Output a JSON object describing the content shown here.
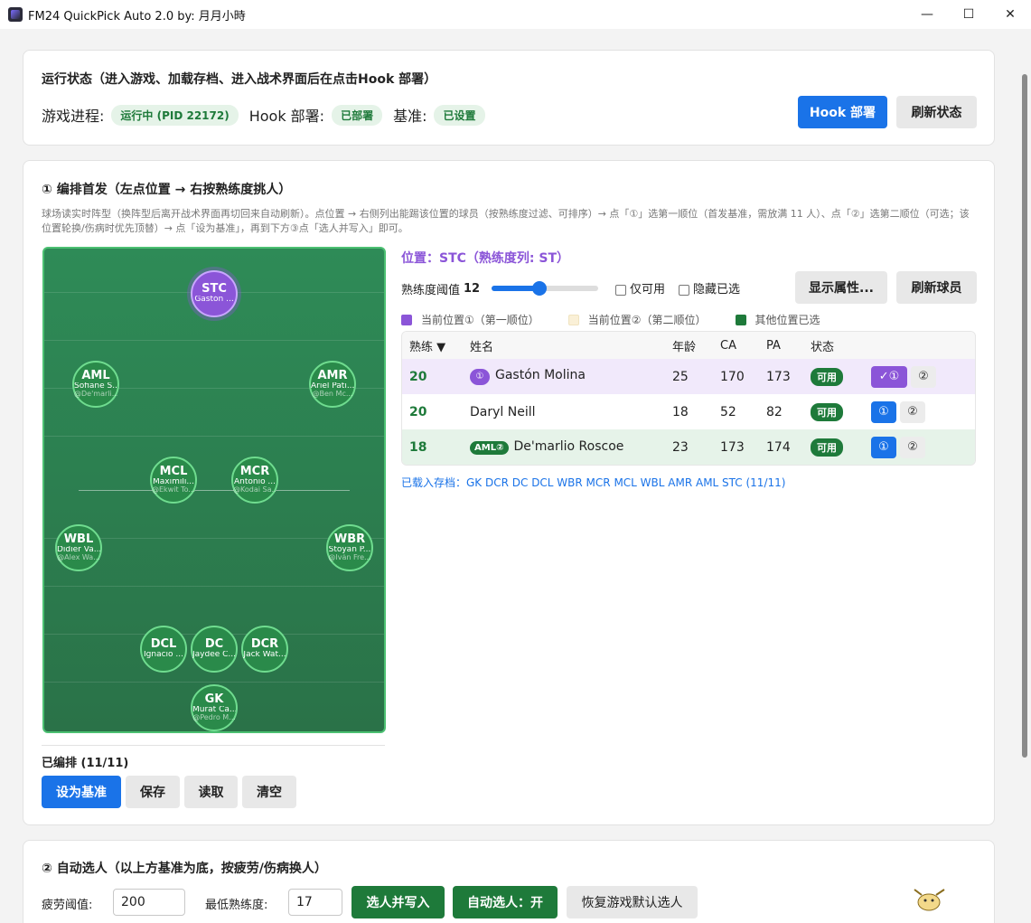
{
  "window": {
    "title": "FM24 QuickPick Auto 2.0 by: 月月小時",
    "minimize": "—",
    "maximize": "☐",
    "close": "✕"
  },
  "status": {
    "title": "运行状态（进入游戏、加载存档、进入战术界面后在点击Hook 部署）",
    "game_label": "游戏进程:",
    "game_value": "运行中 (PID 22172)",
    "hook_label": "Hook 部署:",
    "hook_value": "已部署",
    "base_label": "基准:",
    "base_value": "已设置",
    "hook_button": "Hook 部署",
    "refresh_button": "刷新状态"
  },
  "lineup": {
    "title": "① 编排首发（左点位置 → 右按熟练度挑人）",
    "desc": "球场读实时阵型（换阵型后离开战术界面再切回来自动刷新）。点位置 → 右侧列出能踢该位置的球员（按熟练度过滤、可排序）→ 点「①」选第一顺位（首发基准，需放满 11 人）、点「②」选第二顺位（可选；该位置轮换/伤病时优先顶替）→ 点「设为基准」，再到下方③点「选人并写入」即可。",
    "players": [
      {
        "pos": "STC",
        "name": "Gastón ...",
        "sub": ""
      },
      {
        "pos": "AML",
        "name": "Sofiane S...",
        "sub": "@De'marli..."
      },
      {
        "pos": "AMR",
        "name": "Ariel Pati...",
        "sub": "@Ben Mc..."
      },
      {
        "pos": "MCL",
        "name": "Maximili...",
        "sub": "@Ekwit To..."
      },
      {
        "pos": "MCR",
        "name": "Antonio ...",
        "sub": "@Kodai Sa..."
      },
      {
        "pos": "WBL",
        "name": "Didier Va...",
        "sub": "@Alex Wa..."
      },
      {
        "pos": "WBR",
        "name": "Stoyan P...",
        "sub": "@Iván Fre..."
      },
      {
        "pos": "DCL",
        "name": "Ignacio ...",
        "sub": ""
      },
      {
        "pos": "DC",
        "name": "Jaydee C...",
        "sub": ""
      },
      {
        "pos": "DCR",
        "name": "Jack Wat...",
        "sub": ""
      },
      {
        "pos": "GK",
        "name": "Murat Ca...",
        "sub": "@Pedro M..."
      }
    ],
    "arranged": "已编排 (11/11)",
    "buttons": {
      "set_base": "设为基准",
      "save": "保存",
      "load": "读取",
      "clear": "清空"
    },
    "position_title": "位置：STC（熟练度列: ST）",
    "threshold_label": "熟练度阈值",
    "threshold_value": "12",
    "threshold_fraction": 0.45,
    "only_available": "仅可用",
    "hide_selected": "隐藏已选",
    "show_attr_button": "显示属性...",
    "refresh_players_button": "刷新球员",
    "legend": [
      {
        "label": "当前位置①（第一顺位）",
        "color": "#8b55d8"
      },
      {
        "label": "当前位置②（第二顺位）",
        "color": "#faf0d7"
      },
      {
        "label": "其他位置已选",
        "color": "#1e7a3a"
      }
    ],
    "table": {
      "headers": [
        "熟练 ▼",
        "姓名",
        "年龄",
        "CA",
        "PA",
        "状态"
      ],
      "rows": [
        {
          "rank": "20",
          "tag": "①",
          "name": "Gastón Molina",
          "age": "25",
          "ca": "170",
          "pa": "173",
          "status": "可用",
          "b1": "✓①",
          "b2": "②"
        },
        {
          "rank": "20",
          "tag": "",
          "name": "Daryl Neill",
          "age": "18",
          "ca": "52",
          "pa": "82",
          "status": "可用",
          "b1": "①",
          "b2": "②"
        },
        {
          "rank": "18",
          "tag": "AML②",
          "name": "De'marlio Roscoe",
          "age": "23",
          "ca": "173",
          "pa": "174",
          "status": "可用",
          "b1": "①",
          "b2": "②"
        }
      ]
    },
    "loaded": "已载入存档：GK DCR DC DCL WBR MCR MCL WBL AMR AML STC (11/11)"
  },
  "auto": {
    "title": "② 自动选人（以上方基准为底，按疲劳/伤病换人）",
    "fatigue_label": "疲劳阈值:",
    "fatigue_value": "200",
    "min_label": "最低熟练度:",
    "min_value": "17",
    "pick_button": "选人并写入",
    "auto_button": "自动选人：开",
    "restore_button": "恢复游戏默认选人"
  }
}
